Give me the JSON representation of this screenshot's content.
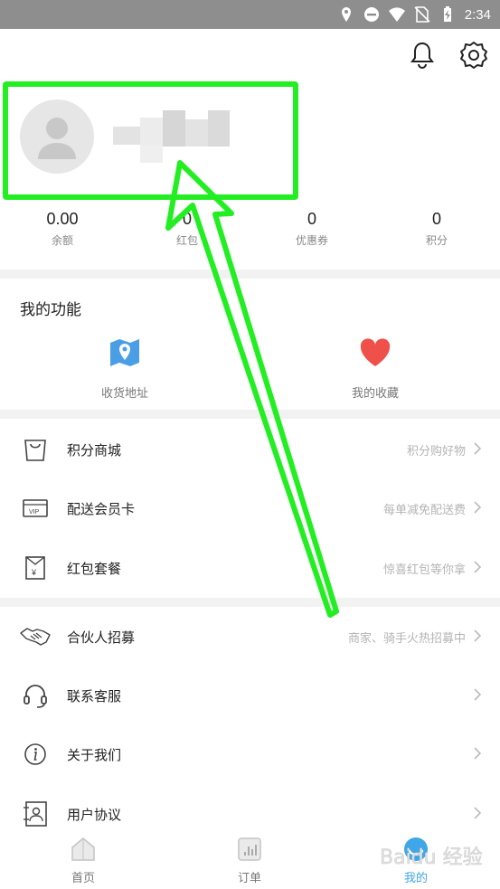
{
  "status_bar": {
    "time": "2:34",
    "icons": [
      "location-icon",
      "do-not-disturb-icon",
      "wifi-icon",
      "no-sim-icon",
      "battery-charging-icon"
    ]
  },
  "header": {
    "icons": [
      "bell-icon",
      "settings-icon"
    ]
  },
  "stats": [
    {
      "value": "0.00",
      "label": "余额"
    },
    {
      "value": "0",
      "label": "红包"
    },
    {
      "value": "0",
      "label": "优惠券"
    },
    {
      "value": "0",
      "label": "积分"
    }
  ],
  "functions": {
    "title": "我的功能",
    "items": [
      {
        "label": "收货地址",
        "icon": "map-location-icon"
      },
      {
        "label": "我的收藏",
        "icon": "heart-icon"
      }
    ]
  },
  "list_group_1": [
    {
      "title": "积分商城",
      "subtitle": "积分购好物",
      "icon": "shopping-bag-icon"
    },
    {
      "title": "配送会员卡",
      "subtitle": "每单减免配送费",
      "icon": "vip-card-icon"
    },
    {
      "title": "红包套餐",
      "subtitle": "惊喜红包等你拿",
      "icon": "red-envelope-icon"
    }
  ],
  "list_group_2": [
    {
      "title": "合伙人招募",
      "subtitle": "商家、骑手火热招募中",
      "icon": "handshake-icon"
    },
    {
      "title": "联系客服",
      "subtitle": "",
      "icon": "headset-icon"
    },
    {
      "title": "关于我们",
      "subtitle": "",
      "icon": "info-icon"
    },
    {
      "title": "用户协议",
      "subtitle": "",
      "icon": "contact-book-icon"
    }
  ],
  "tabs": [
    {
      "label": "首页",
      "icon": "home-icon",
      "active": false
    },
    {
      "label": "订单",
      "icon": "orders-icon",
      "active": false
    },
    {
      "label": "我的",
      "icon": "profile-icon",
      "active": true
    }
  ],
  "watermark": "Baidu 经验",
  "colors": {
    "accent": "#3fa6e8",
    "highlight": "#22ee22",
    "heart": "#f0504a",
    "map": "#4a9ee6"
  }
}
